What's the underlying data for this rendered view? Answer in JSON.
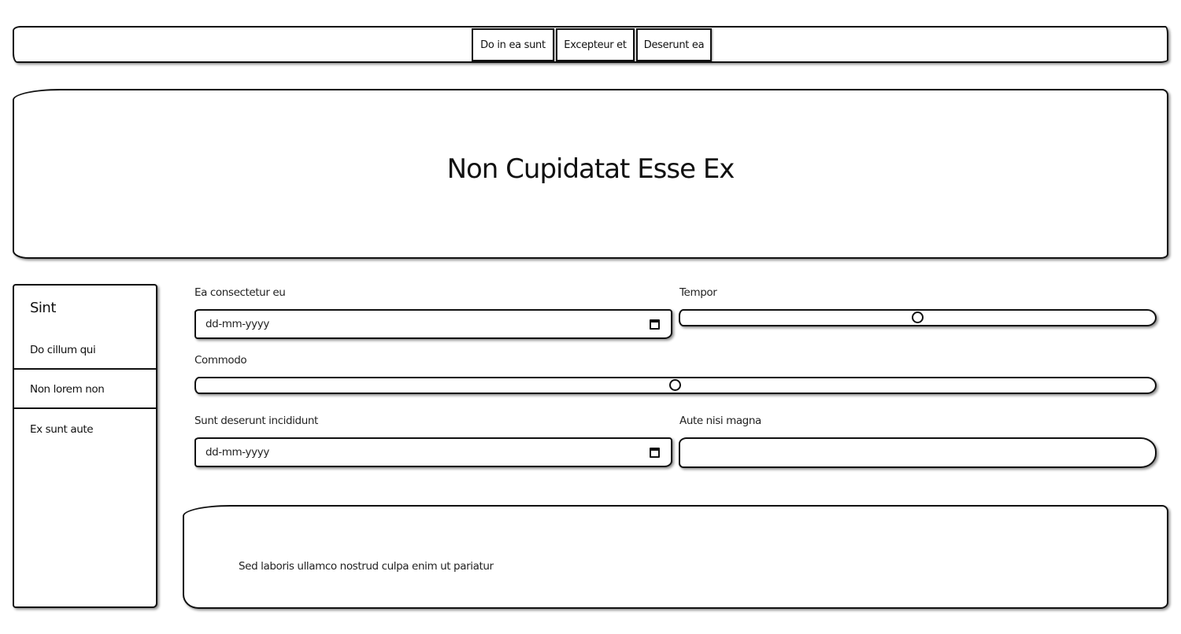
{
  "nav": {
    "buttons": [
      "Do in ea sunt",
      "Excepteur et",
      "Deserunt ea"
    ]
  },
  "hero": {
    "title": "Non Cupidatat Esse Ex"
  },
  "sidebar": {
    "title": "Sint",
    "items": [
      {
        "label": "Do cillum qui"
      },
      {
        "label": "Non lorem non"
      },
      {
        "label": "Ex sunt aute"
      }
    ]
  },
  "form": {
    "field1": {
      "label": "Ea consectetur eu",
      "placeholder": "dd-mm-yyyy",
      "icon": "calendar-icon"
    },
    "field2": {
      "label": "Tempor",
      "value_fraction": 0.5
    },
    "field3": {
      "label": "Commodo",
      "value_fraction": 0.5
    },
    "field4": {
      "label": "Sunt deserunt incididunt",
      "placeholder": "dd-mm-yyyy",
      "icon": "calendar-icon"
    },
    "field5": {
      "label": "Aute nisi magna",
      "value": ""
    }
  },
  "panel": {
    "text": "Sed laboris ullamco nostrud culpa enim ut pariatur"
  }
}
